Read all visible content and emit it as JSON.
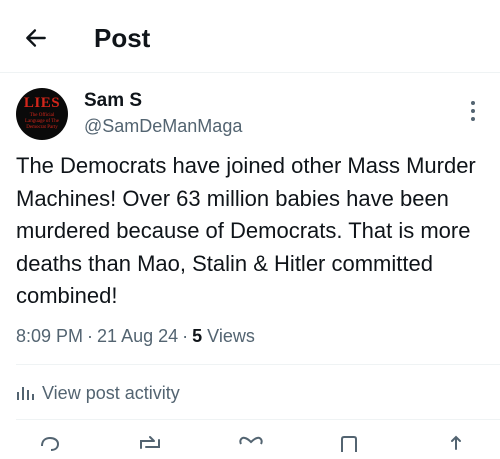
{
  "header": {
    "title": "Post",
    "back_icon": "arrow-left-icon"
  },
  "post": {
    "author": {
      "display_name": "Sam S",
      "handle": "@SamDeManMaga",
      "avatar_text": "LIES",
      "avatar_subtext": "The Official Language of The Democrat Party"
    },
    "text": "The Democrats have joined other Mass Murder Machines! Over 63 million babies have been murdered because of Democrats. That is more deaths than Mao, Stalin & Hitler committed combined!",
    "time": "8:09 PM",
    "date": "21 Aug 24",
    "views_count": "5",
    "views_label": "Views"
  },
  "activity": {
    "label": "View post activity",
    "icon": "bar-chart-icon"
  },
  "actions": [
    "reply-icon",
    "repost-icon",
    "like-icon",
    "bookmark-icon",
    "share-icon"
  ],
  "colors": {
    "text": "#0f1419",
    "secondary": "#536471",
    "divider": "#eff3f4",
    "avatar_red": "#d3261b"
  }
}
